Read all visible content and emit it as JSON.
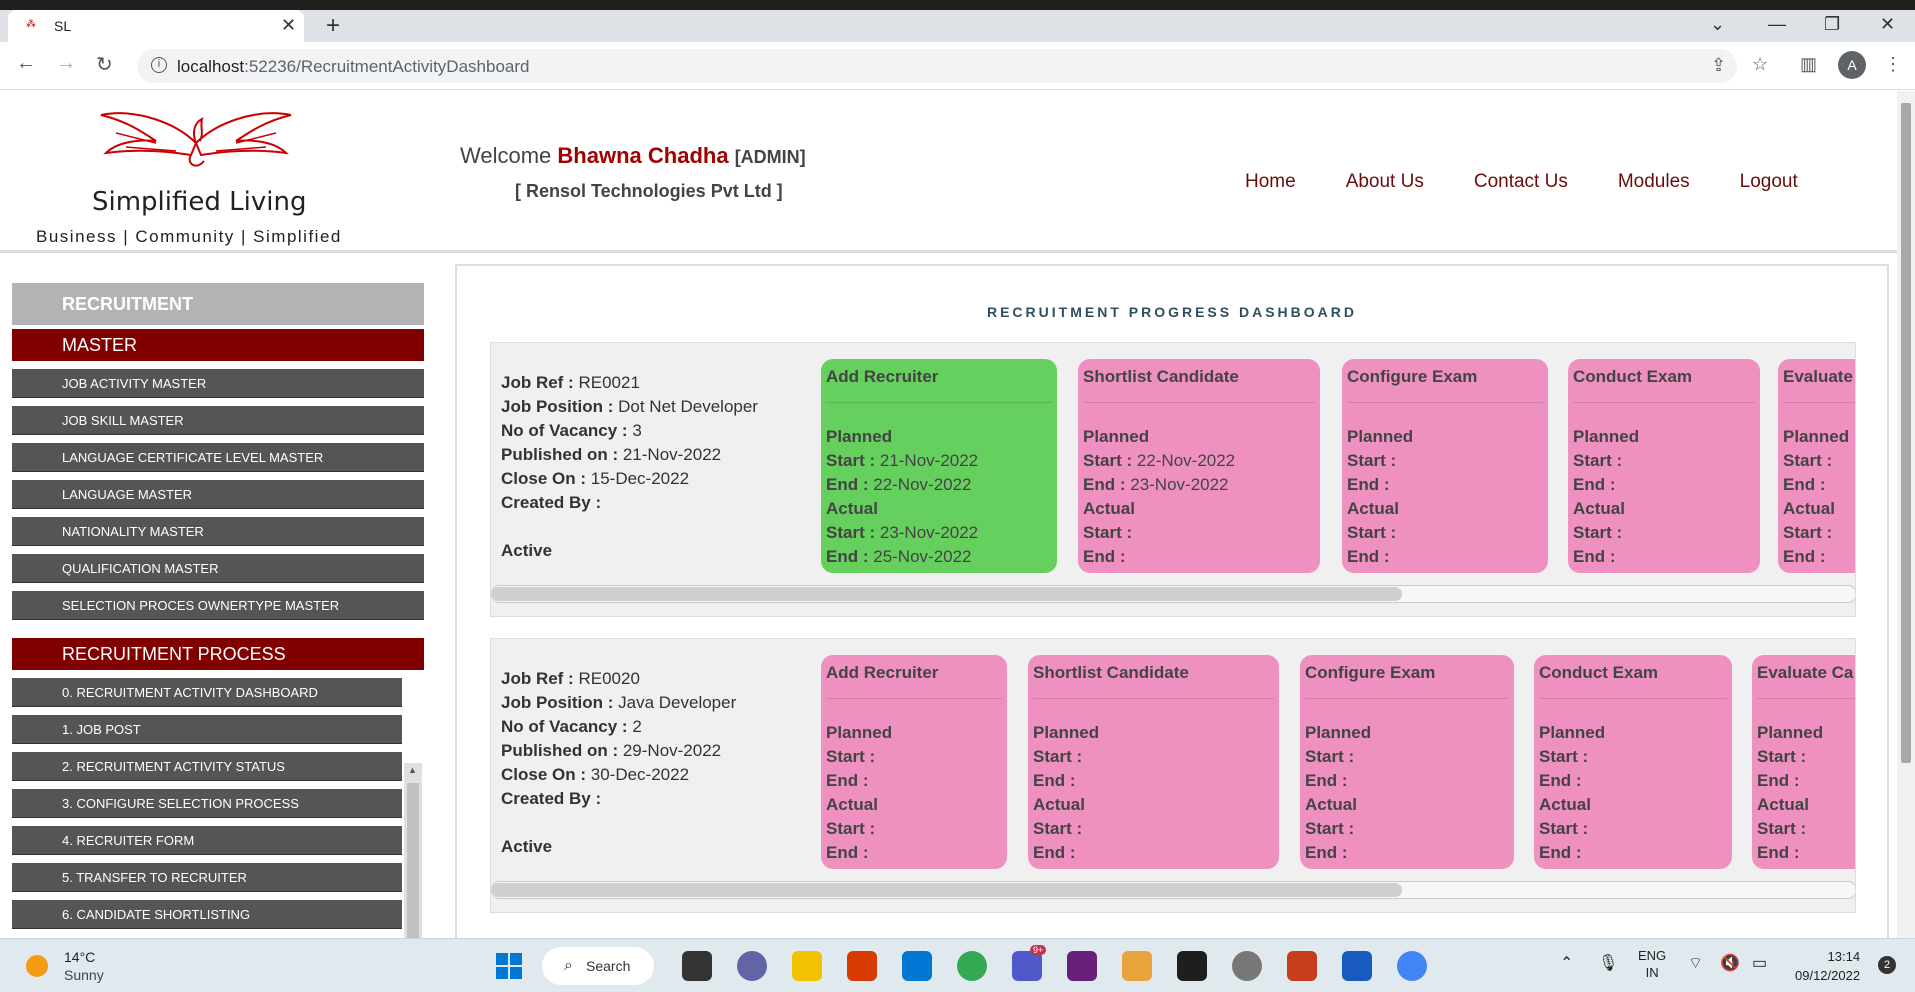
{
  "browser": {
    "tab_title": "SL",
    "url_host": "localhost",
    "url_rest": ":52236/RecruitmentActivityDashboard",
    "avatar_letter": "A"
  },
  "header": {
    "brand": "Simplified Living",
    "tagline": "Business | Community | Simplified",
    "welcome_prefix": "Welcome",
    "user_name": "Bhawna Chadha",
    "role": "[ADMIN]",
    "company": "[ Rensol Technologies Pvt Ltd ]",
    "nav": [
      "Home",
      "About Us",
      "Contact Us",
      "Modules",
      "Logout"
    ]
  },
  "sidebar": {
    "section": "RECRUITMENT",
    "master_title": "MASTER",
    "master_items": [
      "JOB ACTIVITY MASTER",
      "JOB SKILL MASTER",
      "LANGUAGE CERTIFICATE LEVEL MASTER",
      "LANGUAGE MASTER",
      "NATIONALITY MASTER",
      "QUALIFICATION MASTER",
      "SELECTION PROCES OWNERTYPE MASTER"
    ],
    "process_title": "RECRUITMENT PROCESS",
    "process_items": [
      "0. RECRUITMENT ACTIVITY DASHBOARD",
      "1. JOB POST",
      "2. RECRUITMENT ACTIVITY STATUS",
      "3. CONFIGURE SELECTION PROCESS",
      "4. RECRUITER FORM",
      "5. TRANSFER TO RECRUITER",
      "6. CANDIDATE SHORTLISTING"
    ]
  },
  "dashboard": {
    "title": "RECRUITMENT PROGRESS DASHBOARD",
    "labels": {
      "job_ref": "Job Ref :",
      "job_position": "Job Position :",
      "vacancy": "No of Vacancy :",
      "published": "Published on :",
      "close": "Close On :",
      "created": "Created By :",
      "planned": "Planned",
      "actual": "Actual",
      "start": "Start :",
      "end": "End :"
    },
    "jobs": [
      {
        "ref": "RE0021",
        "position": "Dot Net Developer",
        "vacancy": "3",
        "published": "21-Nov-2022",
        "close": "15-Dec-2022",
        "created_by": "",
        "status": "Active",
        "stages": [
          {
            "name": "Add Recruiter",
            "color": "#66d05e",
            "plan_start": "21-Nov-2022",
            "plan_end": "22-Nov-2022",
            "act_start": "23-Nov-2022",
            "act_end": "25-Nov-2022"
          },
          {
            "name": "Shortlist Candidate",
            "color": "#ee91c0",
            "plan_start": "22-Nov-2022",
            "plan_end": "23-Nov-2022",
            "act_start": "",
            "act_end": ""
          },
          {
            "name": "Configure Exam",
            "color": "#ee91c0",
            "plan_start": "",
            "plan_end": "",
            "act_start": "",
            "act_end": ""
          },
          {
            "name": "Conduct Exam",
            "color": "#ee91c0",
            "plan_start": "",
            "plan_end": "",
            "act_start": "",
            "act_end": ""
          },
          {
            "name": "Evaluate",
            "color": "#ee91c0",
            "plan_start": "",
            "plan_end": "",
            "act_start": "",
            "act_end": ""
          }
        ]
      },
      {
        "ref": "RE0020",
        "position": "Java Developer",
        "vacancy": "2",
        "published": "29-Nov-2022",
        "close": "30-Dec-2022",
        "created_by": "",
        "status": "Active",
        "stages": [
          {
            "name": "Add Recruiter",
            "color": "#ee91c0",
            "plan_start": "",
            "plan_end": "",
            "act_start": "",
            "act_end": ""
          },
          {
            "name": "Shortlist Candidate",
            "color": "#ee91c0",
            "plan_start": "",
            "plan_end": "",
            "act_start": "",
            "act_end": ""
          },
          {
            "name": "Configure Exam",
            "color": "#ee91c0",
            "plan_start": "",
            "plan_end": "",
            "act_start": "",
            "act_end": ""
          },
          {
            "name": "Conduct Exam",
            "color": "#ee91c0",
            "plan_start": "",
            "plan_end": "",
            "act_start": "",
            "act_end": ""
          },
          {
            "name": "Evaluate Ca",
            "color": "#ee91c0",
            "plan_start": "",
            "plan_end": "",
            "act_start": "",
            "act_end": ""
          }
        ]
      }
    ]
  },
  "taskbar": {
    "temp": "14°C",
    "weather": "Sunny",
    "search": "Search",
    "lang1": "ENG",
    "lang2": "IN",
    "time": "13:14",
    "date": "09/12/2022",
    "notifications": "2",
    "teams_badge": "9+"
  }
}
